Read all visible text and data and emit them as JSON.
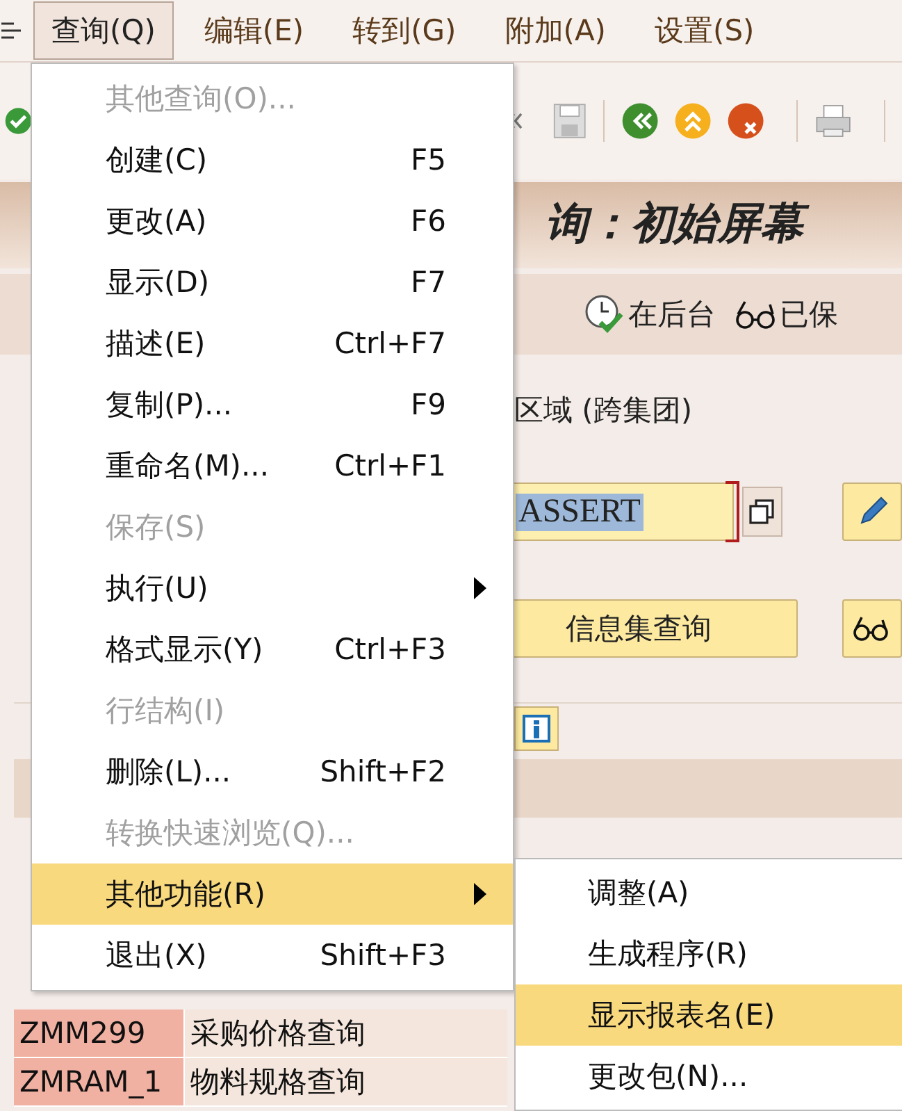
{
  "menubar": [
    {
      "label": "查询(Q)",
      "selected": true
    },
    {
      "label": "编辑(E)",
      "selected": false
    },
    {
      "label": "转到(G)",
      "selected": false
    },
    {
      "label": "附加(A)",
      "selected": false
    },
    {
      "label": "设置(S)",
      "selected": false
    }
  ],
  "title": "询：初始屏幕",
  "app_toolbar": [
    {
      "kind": "clock",
      "label": "在后台"
    },
    {
      "kind": "glasses",
      "label": "已保"
    }
  ],
  "area_label": "区域 (跨集团)",
  "query_field": {
    "value": "ASSERT",
    "selected": true
  },
  "infoset_button": "信息集查询",
  "table": {
    "rows": [
      {
        "name": "ZMM299",
        "title": "采购价格查询",
        "selected": false
      },
      {
        "name": "ZMRAM_1",
        "title": "物料规格查询",
        "selected": false
      }
    ]
  },
  "menu": {
    "items": [
      {
        "label": "其他查询(O)...",
        "disabled": true,
        "submenu": false,
        "selected": false
      },
      {
        "label": "创建(C)",
        "shortcut": "F5",
        "disabled": false,
        "submenu": false,
        "selected": false
      },
      {
        "label": "更改(A)",
        "shortcut": "F6",
        "disabled": false,
        "submenu": false,
        "selected": false
      },
      {
        "label": "显示(D)",
        "shortcut": "F7",
        "disabled": false,
        "submenu": false,
        "selected": false
      },
      {
        "label": "描述(E)",
        "shortcut": "Ctrl+F7",
        "disabled": false,
        "submenu": false,
        "selected": false
      },
      {
        "label": "复制(P)...",
        "shortcut": "F9",
        "disabled": false,
        "submenu": false,
        "selected": false
      },
      {
        "label": "重命名(M)...",
        "shortcut": "Ctrl+F1",
        "disabled": false,
        "submenu": false,
        "selected": false
      },
      {
        "label": "保存(S)",
        "disabled": true,
        "submenu": false,
        "selected": false
      },
      {
        "label": "执行(U)",
        "disabled": false,
        "submenu": true,
        "selected": false
      },
      {
        "label": "格式显示(Y)",
        "shortcut": "Ctrl+F3",
        "disabled": false,
        "submenu": false,
        "selected": false
      },
      {
        "label": "行结构(I)",
        "disabled": true,
        "submenu": false,
        "selected": false
      },
      {
        "label": "删除(L)...",
        "shortcut": "Shift+F2",
        "disabled": false,
        "submenu": false,
        "selected": false
      },
      {
        "label": "转换快速浏览(Q)...",
        "disabled": true,
        "submenu": false,
        "selected": false
      },
      {
        "label": "其他功能(R)",
        "disabled": false,
        "submenu": true,
        "selected": true
      },
      {
        "label": "退出(X)",
        "shortcut": "Shift+F3",
        "disabled": false,
        "submenu": false,
        "selected": false
      }
    ]
  },
  "submenu": {
    "items": [
      {
        "label": "调整(A)",
        "selected": false
      },
      {
        "label": "生成程序(R)",
        "selected": false
      },
      {
        "label": "显示报表名(E)",
        "selected": true
      },
      {
        "label": "更改包(N)...",
        "selected": false
      }
    ]
  }
}
